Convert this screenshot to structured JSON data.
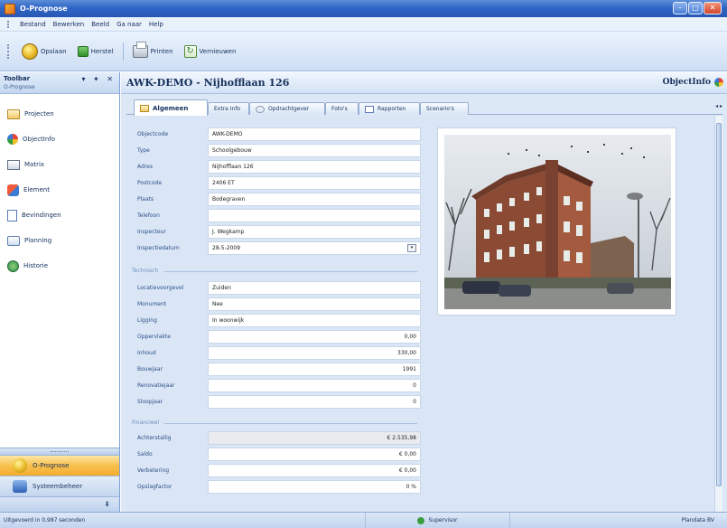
{
  "window": {
    "title": "O-Prognose",
    "buttons": [
      "–",
      "□",
      "✕"
    ]
  },
  "menu": [
    "Bestand",
    "Bewerken",
    "Beeld",
    "Ga naar",
    "Help"
  ],
  "toolbar": {
    "save": "Opslaan",
    "restore": "Herstel",
    "print": "Printen",
    "refresh": "Vernieuwen"
  },
  "left_pane": {
    "title": "Toolbar",
    "subtitle": "O-Prognose",
    "controls": "▾ ✦ ✕",
    "items": [
      {
        "label": "Projecten",
        "icon": "folder-icon"
      },
      {
        "label": "ObjectInfo",
        "icon": "objectinfo-icon"
      },
      {
        "label": "Matrix",
        "icon": "matrix-icon"
      },
      {
        "label": "Element",
        "icon": "element-icon"
      },
      {
        "label": "Bevindingen",
        "icon": "document-icon"
      },
      {
        "label": "Planning",
        "icon": "planning-icon"
      },
      {
        "label": "Historie",
        "icon": "history-icon"
      }
    ],
    "bottom_nav": [
      {
        "label": "O-Prognose",
        "active": true
      },
      {
        "label": "Systeembeheer",
        "active": false
      }
    ]
  },
  "main": {
    "title": "AWK-DEMO - Nijhofflaan 126",
    "right_title": "ObjectInfo",
    "tabs": [
      "Algemeen",
      "Extra Info",
      "Opdrachtgever",
      "Foto's",
      "Rapporten",
      "Scenario's"
    ],
    "general_fields": [
      {
        "label": "Objectcode",
        "value": "AWK-DEMO"
      },
      {
        "label": "Type",
        "value": "Schoolgebouw"
      },
      {
        "label": "Adres",
        "value": "Nijhofflaan 126"
      },
      {
        "label": "Postcode",
        "value": "2406 ET"
      },
      {
        "label": "Plaats",
        "value": "Bodegraven"
      },
      {
        "label": "Telefoon",
        "value": ""
      },
      {
        "label": "Inspecteur",
        "value": "J. Wegkamp"
      },
      {
        "label": "Inspectiedatum",
        "value": "28-5-2009"
      }
    ],
    "technical_section": "Technisch",
    "technical_fields": [
      {
        "label": "Locatievoorgevel",
        "value": "Zuiden"
      },
      {
        "label": "Monument",
        "value": "Nee"
      },
      {
        "label": "Ligging",
        "value": "In woonwijk"
      },
      {
        "label": "Oppervlakte",
        "value": "0,00"
      },
      {
        "label": "Inhoud",
        "value": "330,00"
      },
      {
        "label": "Bouwjaar",
        "value": "1991"
      },
      {
        "label": "Renovatiejaar",
        "value": "0"
      },
      {
        "label": "Sloopjaar",
        "value": "0"
      }
    ],
    "financial_section": "Financieel",
    "financial_fields": [
      {
        "label": "Achterstallig",
        "value": "€ 2.535,98"
      },
      {
        "label": "Saldo",
        "value": "€ 0,00"
      },
      {
        "label": "Verbetering",
        "value": "€ 0,00"
      },
      {
        "label": "Opslagfactor",
        "value": "0 %"
      }
    ]
  },
  "status": {
    "left": "Uitgevoerd in 0,987 seconden",
    "user": "Supervisor",
    "company": "Plandata BV"
  },
  "colors": {
    "accent": "#f4ac2f",
    "title_bar": "#2f65c7",
    "label_blue": "#2a4f8a"
  }
}
